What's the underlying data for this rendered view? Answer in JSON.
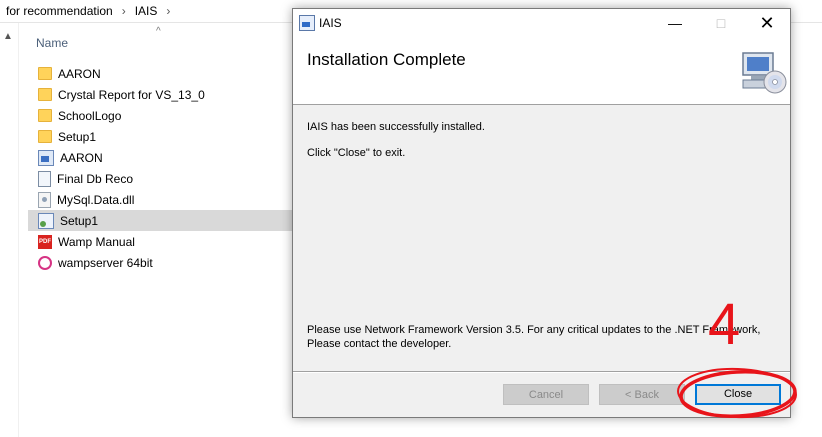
{
  "explorer": {
    "breadcrumb": [
      "for recommendation",
      "IAIS"
    ],
    "column_header": "Name",
    "files": [
      {
        "name": "AARON",
        "icon": "folder-icon"
      },
      {
        "name": "Crystal Report for VS_13_0",
        "icon": "folder-icon"
      },
      {
        "name": "SchoolLogo",
        "icon": "folder-icon"
      },
      {
        "name": "Setup1",
        "icon": "folder-icon"
      },
      {
        "name": "AARON",
        "icon": "application-icon"
      },
      {
        "name": "Final Db Reco",
        "icon": "document-icon"
      },
      {
        "name": "MySql.Data.dll",
        "icon": "dll-icon"
      },
      {
        "name": "Setup1",
        "icon": "setup-icon",
        "selected": true
      },
      {
        "name": "Wamp Manual",
        "icon": "pdf-icon"
      },
      {
        "name": "wampserver 64bit",
        "icon": "wamp-icon"
      }
    ]
  },
  "dialog": {
    "title": "IAIS",
    "heading": "Installation Complete",
    "message_installed": "IAIS has been successfully installed.",
    "message_exit": "Click \"Close\" to exit.",
    "message_framework": "Please use Network Framework Version 3.5. For any critical updates to the .NET Framework, Please contact the developer.",
    "buttons": {
      "cancel": "Cancel",
      "back": "< Back",
      "close": "Close"
    }
  },
  "annotation": {
    "step_number": "4",
    "color": "#e8141a"
  },
  "colors": {
    "selection": "#d9d9d9",
    "default_button_border": "#0078d7",
    "dialog_bg": "#f0f0f0"
  }
}
